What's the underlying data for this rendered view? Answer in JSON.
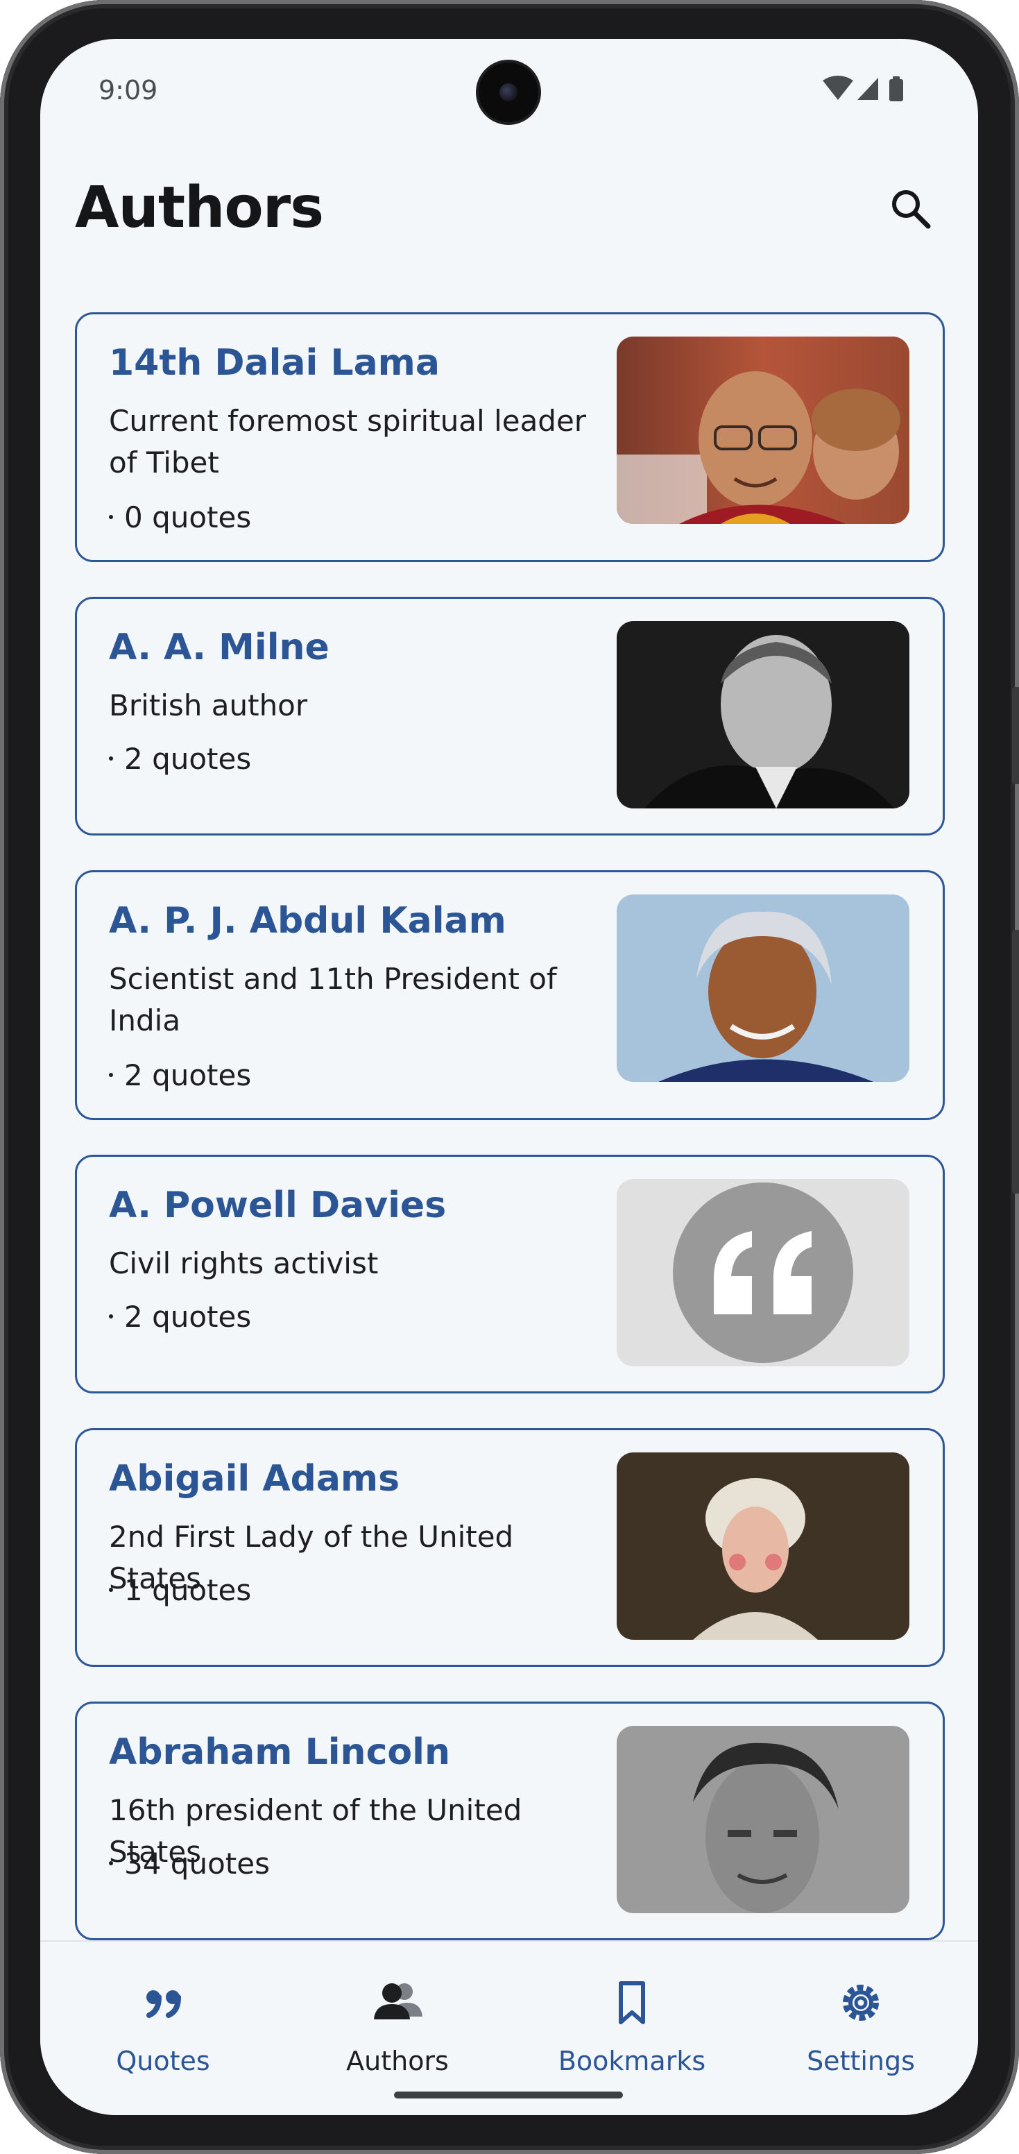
{
  "status_bar": {
    "time": "9:09"
  },
  "app_bar": {
    "title": "Authors"
  },
  "authors": [
    {
      "name": "14th Dalai Lama",
      "description": "Current foremost spiritual leader of Tibet",
      "quotes": "0 quotes"
    },
    {
      "name": "A. A. Milne",
      "description": "British author",
      "quotes": "2 quotes"
    },
    {
      "name": "A. P. J. Abdul Kalam",
      "description": "Scientist and 11th President of India",
      "quotes": "2 quotes"
    },
    {
      "name": "A. Powell Davies",
      "description": "Civil rights activist",
      "quotes": "2 quotes"
    },
    {
      "name": "Abigail Adams",
      "description": "2nd First Lady of the United States",
      "quotes": "1 quotes"
    },
    {
      "name": "Abraham Lincoln",
      "description": "16th president of the United States",
      "quotes": "34 quotes"
    }
  ],
  "bottom_nav": {
    "items": [
      {
        "label": "Quotes",
        "icon": "quote-icon",
        "active": false
      },
      {
        "label": "Authors",
        "icon": "people-icon",
        "active": true
      },
      {
        "label": "Bookmarks",
        "icon": "bookmark-icon",
        "active": false
      },
      {
        "label": "Settings",
        "icon": "gear-icon",
        "active": false
      }
    ]
  },
  "colors": {
    "accent": "#2b5594",
    "card_border": "#2d5797",
    "background": "#f3f7f9",
    "text": "#1c1e20"
  }
}
